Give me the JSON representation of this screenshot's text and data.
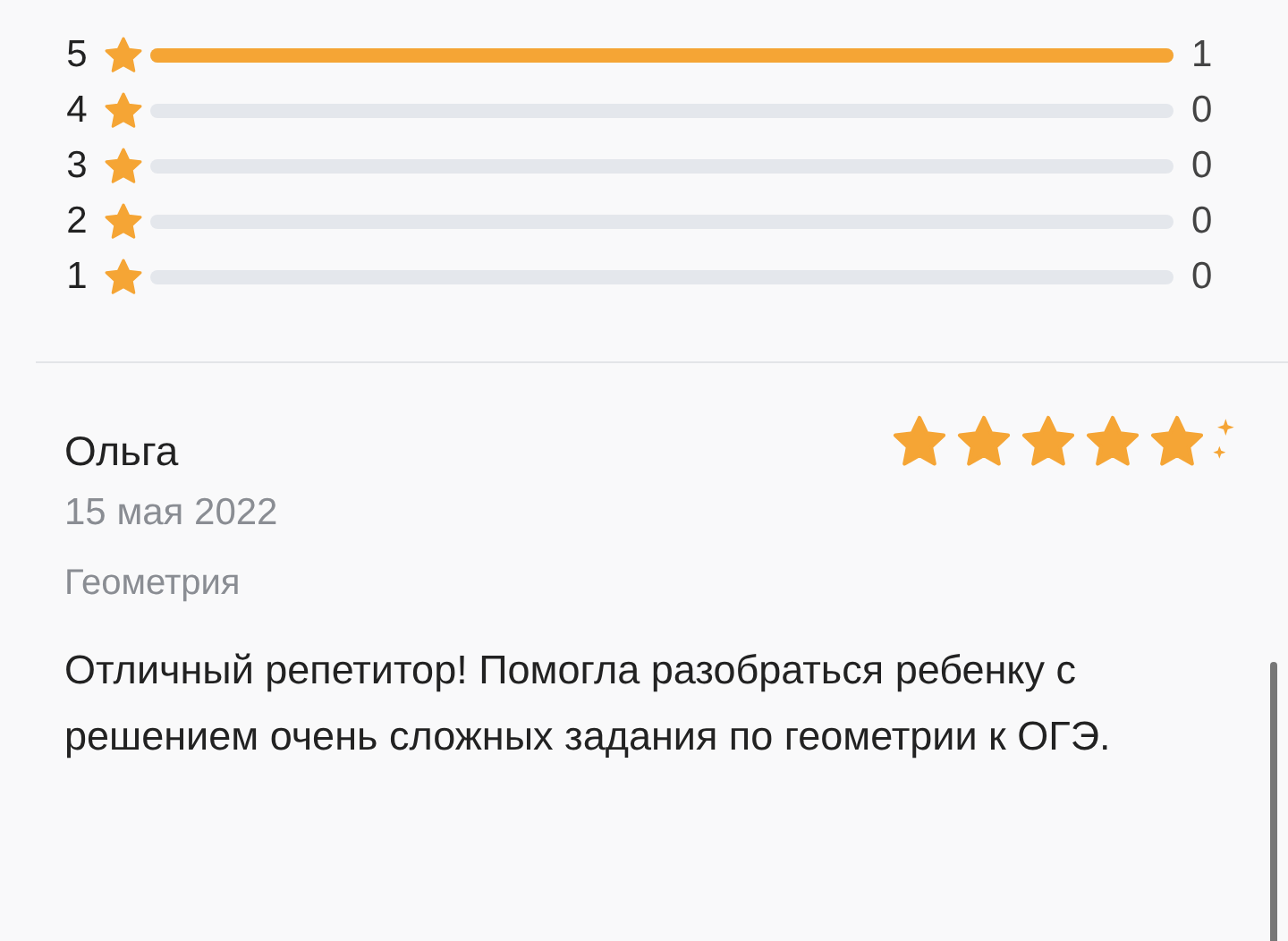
{
  "rating_breakdown": [
    {
      "score": "5",
      "level": 1,
      "count": "1"
    },
    {
      "score": "4",
      "level": 0,
      "count": "0"
    },
    {
      "score": "3",
      "level": 0,
      "count": "0"
    },
    {
      "score": "2",
      "level": 0,
      "count": "0"
    },
    {
      "score": "1",
      "level": 0,
      "count": "0"
    }
  ],
  "review": {
    "author": "Ольга",
    "stars": 5,
    "date": "15 мая 2022",
    "subject": "Геометрия",
    "text": "Отличный репетитор! Помогла разобраться ребенку с решением очень сложных задания по геометрии к ОГЭ."
  }
}
